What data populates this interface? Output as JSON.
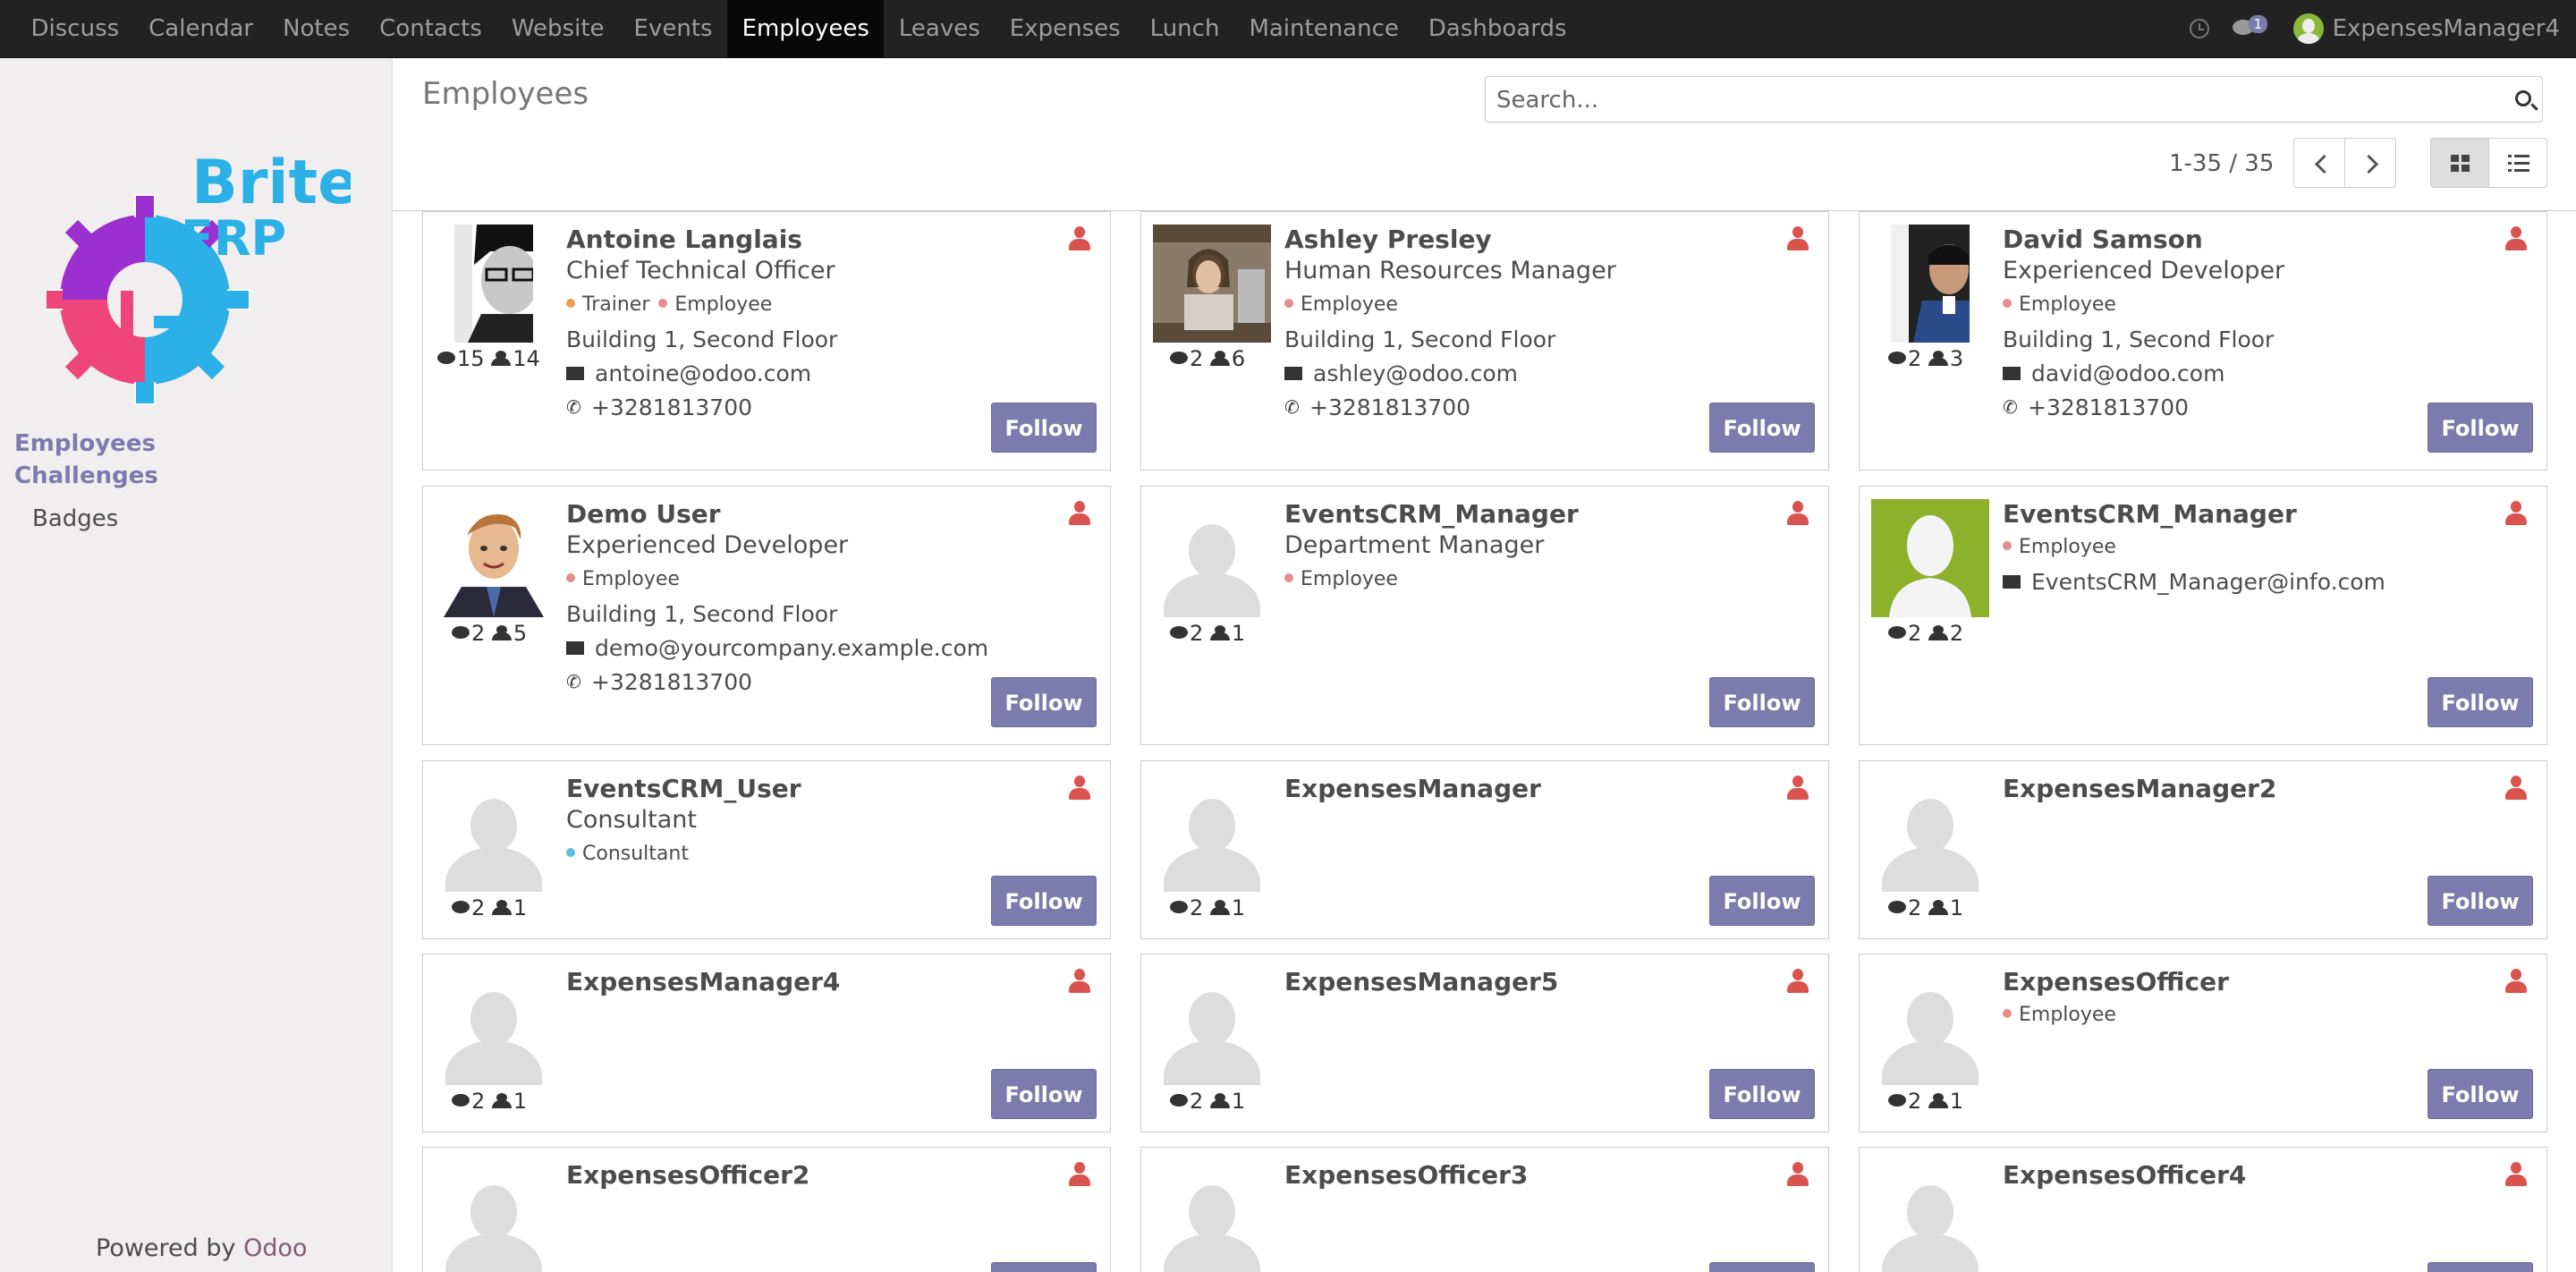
{
  "topbar": {
    "menu": [
      "Discuss",
      "Calendar",
      "Notes",
      "Contacts",
      "Website",
      "Events",
      "Employees",
      "Leaves",
      "Expenses",
      "Lunch",
      "Maintenance",
      "Dashboards"
    ],
    "active_index": 6,
    "chat_count": "1",
    "user_name": "ExpensesManager4"
  },
  "sidebar": {
    "logo_text_1": "Brite",
    "logo_text_2": "ERP",
    "link_employees": "Employees",
    "link_challenges": "Challenges",
    "link_badges": "Badges",
    "powered_prefix": "Powered by",
    "powered_brand": "Odoo"
  },
  "control": {
    "title": "Employees",
    "search_placeholder": "Search...",
    "pager": "1-35 / 35"
  },
  "follow_label": "Follow",
  "colors": {
    "primary": "#7c7bad",
    "user_icon": "#d9534f",
    "tag_employee": "#e88b8b",
    "tag_trainer": "#f0a04b",
    "tag_consultant": "#5bc0de"
  },
  "employees": [
    {
      "name": "Antoine Langlais",
      "job": "Chief Technical Officer",
      "tags": [
        {
          "label": "Trainer",
          "color": "#f0a04b"
        },
        {
          "label": "Employee",
          "color": "#e88b8b"
        }
      ],
      "location": "Building 1, Second Floor",
      "email": "antoine@odoo.com",
      "phone": "+3281813700",
      "messages": "15",
      "followers": "14",
      "photo": "antoine"
    },
    {
      "name": "Ashley Presley",
      "job": "Human Resources Manager",
      "tags": [
        {
          "label": "Employee",
          "color": "#e88b8b"
        }
      ],
      "location": "Building 1, Second Floor",
      "email": "ashley@odoo.com",
      "phone": "+3281813700",
      "messages": "2",
      "followers": "6",
      "photo": "ashley"
    },
    {
      "name": "David Samson",
      "job": "Experienced Developer",
      "tags": [
        {
          "label": "Employee",
          "color": "#e88b8b"
        }
      ],
      "location": "Building 1, Second Floor",
      "email": "david@odoo.com",
      "phone": "+3281813700",
      "messages": "2",
      "followers": "3",
      "photo": "david"
    },
    {
      "name": "Demo User",
      "job": "Experienced Developer",
      "tags": [
        {
          "label": "Employee",
          "color": "#e88b8b"
        }
      ],
      "location": "Building 1, Second Floor",
      "email": "demo@yourcompany.example.com",
      "phone": "+3281813700",
      "messages": "2",
      "followers": "5",
      "photo": "demo"
    },
    {
      "name": "EventsCRM_Manager",
      "job": "Department Manager",
      "tags": [
        {
          "label": "Employee",
          "color": "#e88b8b"
        }
      ],
      "messages": "2",
      "followers": "1",
      "photo": ""
    },
    {
      "name": "EventsCRM_Manager",
      "tags": [
        {
          "label": "Employee",
          "color": "#e88b8b"
        }
      ],
      "email": "EventsCRM_Manager@info.com",
      "messages": "2",
      "followers": "2",
      "photo": "green"
    },
    {
      "name": "EventsCRM_User",
      "job": "Consultant",
      "tags": [
        {
          "label": "Consultant",
          "color": "#5bc0de"
        }
      ],
      "messages": "2",
      "followers": "1",
      "photo": ""
    },
    {
      "name": "ExpensesManager",
      "messages": "2",
      "followers": "1",
      "photo": ""
    },
    {
      "name": "ExpensesManager2",
      "messages": "2",
      "followers": "1",
      "photo": ""
    },
    {
      "name": "ExpensesManager4",
      "messages": "2",
      "followers": "1",
      "photo": ""
    },
    {
      "name": "ExpensesManager5",
      "messages": "2",
      "followers": "1",
      "photo": ""
    },
    {
      "name": "ExpensesOfficer",
      "tags": [
        {
          "label": "Employee",
          "color": "#e88b8b"
        }
      ],
      "messages": "2",
      "followers": "1",
      "photo": ""
    },
    {
      "name": "ExpensesOfficer2",
      "photo": ""
    },
    {
      "name": "ExpensesOfficer3",
      "photo": ""
    },
    {
      "name": "ExpensesOfficer4",
      "photo": ""
    }
  ]
}
